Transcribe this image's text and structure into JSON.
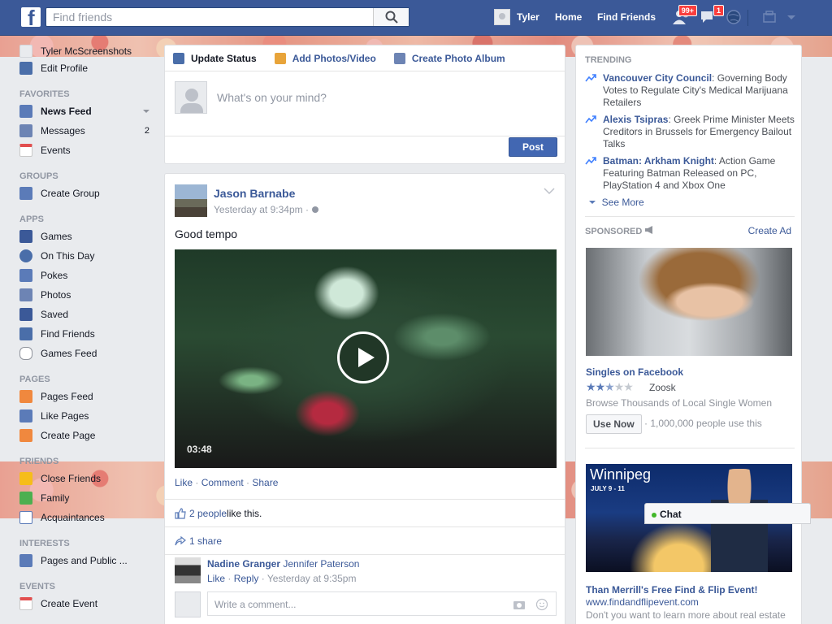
{
  "topbar": {
    "search_placeholder": "Find friends",
    "user_name": "Tyler",
    "home": "Home",
    "find_friends": "Find Friends",
    "friend_requests_badge": "99+",
    "messages_badge": "1"
  },
  "left": {
    "profile_name": "Tyler McScreenshots",
    "edit_profile": "Edit Profile",
    "favorites_header": "FAVORITES",
    "favorites": [
      {
        "label": "News Feed",
        "count": ""
      },
      {
        "label": "Messages",
        "count": "2"
      },
      {
        "label": "Events",
        "count": ""
      }
    ],
    "groups_header": "GROUPS",
    "groups": [
      {
        "label": "Create Group"
      }
    ],
    "apps_header": "APPS",
    "apps": [
      {
        "label": "Games"
      },
      {
        "label": "On This Day"
      },
      {
        "label": "Pokes"
      },
      {
        "label": "Photos"
      },
      {
        "label": "Saved"
      },
      {
        "label": "Find Friends"
      },
      {
        "label": "Games Feed"
      }
    ],
    "pages_header": "PAGES",
    "pages": [
      {
        "label": "Pages Feed"
      },
      {
        "label": "Like Pages"
      },
      {
        "label": "Create Page"
      }
    ],
    "friends_header": "FRIENDS",
    "friends": [
      {
        "label": "Close Friends"
      },
      {
        "label": "Family"
      },
      {
        "label": "Acquaintances"
      }
    ],
    "interests_header": "INTERESTS",
    "interests": [
      {
        "label": "Pages and Public ..."
      }
    ],
    "events_header": "EVENTS",
    "events": [
      {
        "label": "Create Event"
      }
    ]
  },
  "composer": {
    "tab_update": "Update Status",
    "tab_photos": "Add Photos/Video",
    "tab_album": "Create Photo Album",
    "placeholder": "What's on your mind?",
    "post": "Post"
  },
  "story": {
    "author": "Jason Barnabe",
    "time": "Yesterday at 9:34pm · ",
    "text": "Good tempo",
    "duration": "03:48",
    "like": "Like",
    "comment": "Comment",
    "share": "Share",
    "likes_link": "2 people",
    "likes_suffix": " like this.",
    "shares": "1 share",
    "comment_author": "Nadine Granger",
    "comment_text": "Jennifer Paterson",
    "comment_like": "Like",
    "comment_reply": "Reply",
    "comment_time": "Yesterday at 9:35pm",
    "write_comment": "Write a comment..."
  },
  "right": {
    "trending_header": "TRENDING",
    "trends": [
      {
        "topic": "Vancouver City Council",
        "desc": ": Governing Body Votes to Regulate City's Medical Marijuana Retailers"
      },
      {
        "topic": "Alexis Tsipras",
        "desc": ": Greek Prime Minister Meets Creditors in Brussels for Emergency Bailout Talks"
      },
      {
        "topic": "Batman: Arkham Knight",
        "desc": ": Action Game Featuring Batman Released on PC, PlayStation 4 and Xbox One"
      }
    ],
    "see_more": "See More",
    "sponsored_header": "SPONSORED",
    "create_ad": "Create Ad",
    "ad1_title": "Singles on Facebook",
    "ad1_rating": 2.5,
    "ad1_brand": "Zoosk",
    "ad1_desc": "Browse Thousands of Local Single Women",
    "ad1_button": "Use Now",
    "ad1_meta": "· 1,000,000 people use this",
    "ad2_city": "Winnipeg",
    "ad2_dates": "JULY 9 - 11",
    "ad2_title": "Than Merrill's Free Find & Flip Event!",
    "ad2_url": "www.findandflipevent.com",
    "ad2_desc": "Don't you want to learn more about real estate"
  },
  "chat": {
    "label": "Chat"
  }
}
